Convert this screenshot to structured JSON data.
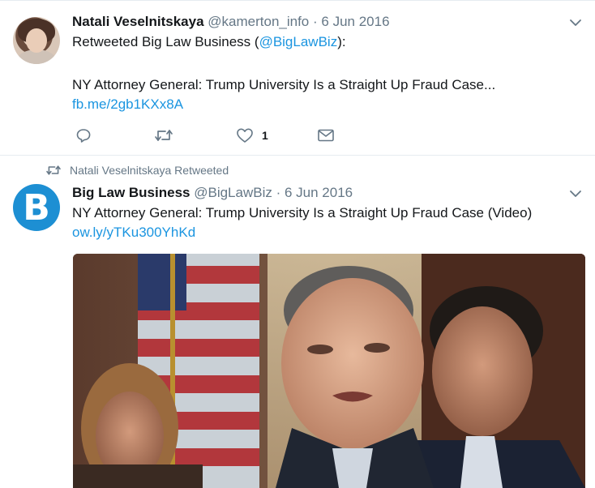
{
  "tweets": [
    {
      "name": "Natali Veselnitskaya",
      "handle": "@kamerton_info",
      "separator": "·",
      "date": "6 Jun 2016",
      "line1_prefix": "Retweeted Big Law Business (",
      "line1_mention": "@BigLawBiz",
      "line1_suffix": "):",
      "line2": "NY Attorney General: Trump University Is a Straight Up Fraud Case...",
      "link": "fb.me/2gb1KXx8A",
      "like_count": "1",
      "icons": [
        "reply-icon",
        "retweet-icon",
        "like-icon",
        "direct-message-icon",
        "chevron-down-icon"
      ]
    },
    {
      "context": "Natali Veselnitskaya Retweeted",
      "name": "Big Law Business",
      "handle": "@BigLawBiz",
      "separator": "·",
      "date": "6 Jun 2016",
      "avatar_letter": "B",
      "text": "NY Attorney General: Trump University Is a Straight Up Fraud Case (Video)",
      "link": "ow.ly/yTKu300YhKd",
      "icons": [
        "retweet-icon",
        "chevron-down-icon"
      ]
    }
  ],
  "colors": {
    "link": "#1b95e0",
    "secondary_text": "#657786",
    "primary_text": "#14171a",
    "avatar_brand": "#1d8fd3",
    "divider": "#e6ecf0"
  }
}
